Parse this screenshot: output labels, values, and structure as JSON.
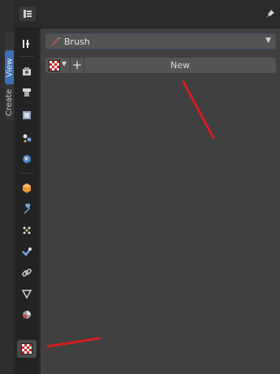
{
  "sidebar_tabs": {
    "view": "View",
    "create": "Create"
  },
  "brush_selector": {
    "label": "Brush"
  },
  "texture": {
    "new_label": "New",
    "plus": "+"
  },
  "icons": {
    "header": "editor-type-icon",
    "pin": "pin-icon",
    "strip": [
      "tool-icon",
      "render-icon",
      "output-icon",
      "view-layer-icon",
      "scene-icon",
      "world-icon",
      "object-icon",
      "modifier-icon",
      "particles-icon",
      "physics-icon",
      "constraints-icon",
      "object-data-icon",
      "material-icon",
      "texture-icon"
    ]
  },
  "colors": {
    "annotation": "#d42020",
    "accent": "#3f6fb0"
  }
}
